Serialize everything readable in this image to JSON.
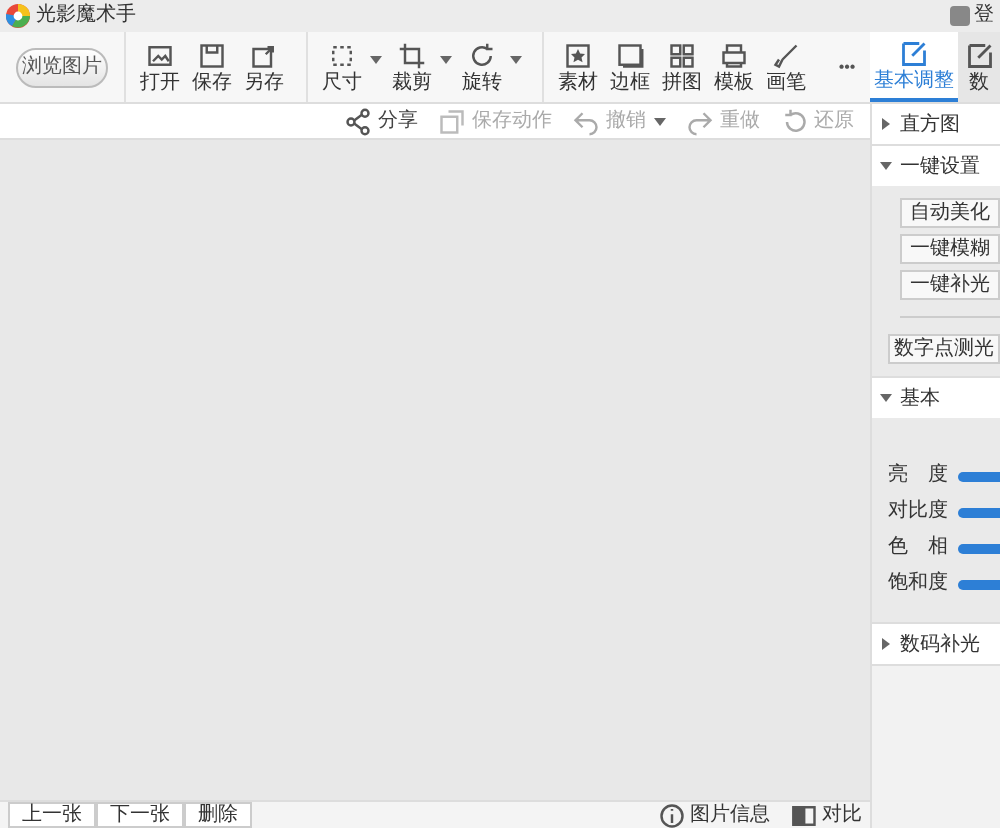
{
  "window": {
    "title": "光影魔术手",
    "login": "登"
  },
  "browse_button": "浏览图片",
  "toolbar_groups": [
    [
      {
        "label": "打开",
        "menu": false
      },
      {
        "label": "保存",
        "menu": false
      },
      {
        "label": "另存",
        "menu": false
      }
    ],
    [
      {
        "label": "尺寸",
        "menu": true
      },
      {
        "label": "裁剪",
        "menu": true
      },
      {
        "label": "旋转",
        "menu": true
      }
    ],
    [
      {
        "label": "素材",
        "menu": false
      },
      {
        "label": "边框",
        "menu": false
      },
      {
        "label": "拼图",
        "menu": false
      },
      {
        "label": "模板",
        "menu": false
      },
      {
        "label": "画笔",
        "menu": false
      }
    ]
  ],
  "more_button": "•••",
  "panel_tabs": [
    {
      "label": "基本调整",
      "selected": true
    },
    {
      "label": "数",
      "selected": false
    }
  ],
  "actions": [
    {
      "label": "分享",
      "disabled": false,
      "menu": false
    },
    {
      "label": "保存动作",
      "disabled": true,
      "menu": false
    },
    {
      "label": "撤销",
      "disabled": true,
      "menu": true
    },
    {
      "label": "重做",
      "disabled": true,
      "menu": false
    },
    {
      "label": "还原",
      "disabled": true,
      "menu": false
    }
  ],
  "sections": [
    {
      "title": "直方图",
      "expanded": false
    },
    {
      "title": "一键设置",
      "expanded": true,
      "kind": "buttons",
      "buttons": [
        "自动美化",
        "一键模糊",
        "一键补光"
      ],
      "extra_button": "数字点测光"
    },
    {
      "title": "基本",
      "expanded": true,
      "kind": "sliders",
      "sliders": [
        "亮　度",
        "对比度",
        "色　相",
        "饱和度"
      ]
    },
    {
      "title": "数码补光",
      "expanded": false
    }
  ],
  "nav_buttons": [
    "上一张",
    "下一张",
    "删除"
  ],
  "status_items": [
    "图片信息",
    "对比"
  ]
}
